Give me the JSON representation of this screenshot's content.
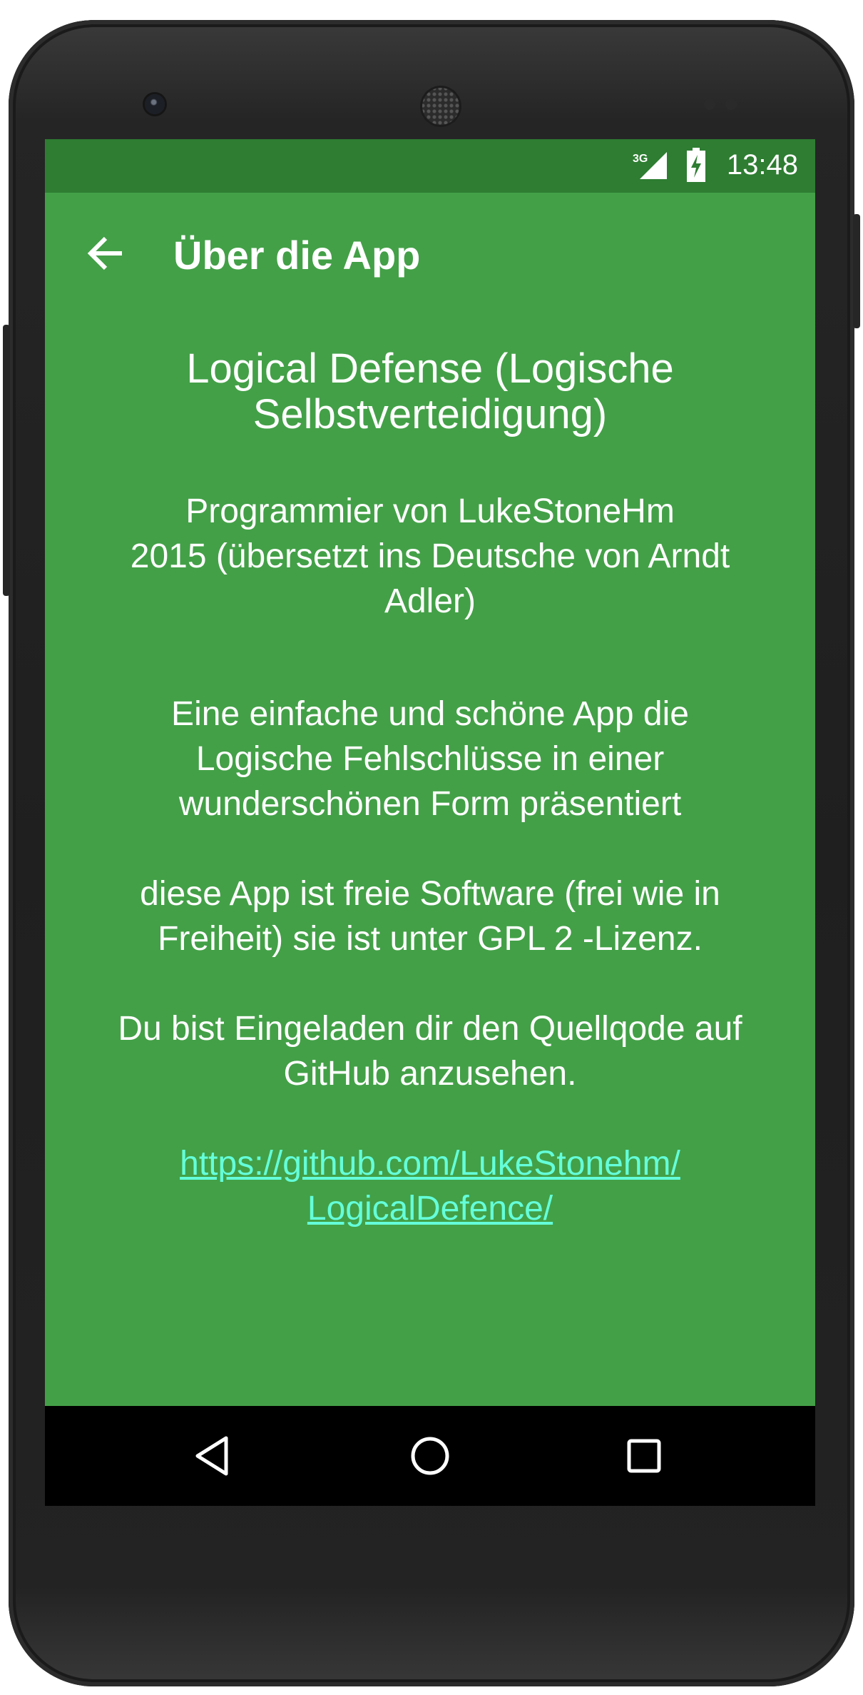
{
  "status_bar": {
    "network": "3G",
    "time": "13:48"
  },
  "toolbar": {
    "title": "Über die App"
  },
  "about": {
    "app_title_line1": "Logical Defense (Logische",
    "app_title_line2": "Selbstverteidigung)",
    "credit_line1": "Programmier von LukeStoneHm",
    "credit_line2": "2015 (übersetzt ins Deutsche von Arndt",
    "credit_line3": "Adler)",
    "description_line1": "Eine einfache und schöne App die",
    "description_line2": "Logische Fehlschlüsse in einer",
    "description_line3": "wunderschönen Form präsentiert",
    "license_line1": "diese App ist freie Software (frei wie in",
    "license_line2": "Freiheit) sie ist unter GPL 2 -Lizenz.",
    "invite_line1": "Du bist Eingeladen dir den Quellqode auf",
    "invite_line2": "GitHub anzusehen.",
    "link_line1": "https://github.com/LukeStonehm/",
    "link_line2": "LogicalDefence/"
  },
  "colors": {
    "background": "#43a047",
    "status_bar": "#2e7d32",
    "link": "#64ffda",
    "nav_bar": "#000000"
  },
  "icons": {
    "back": "arrow-left-icon",
    "signal": "cell-signal-icon",
    "battery": "battery-charging-icon",
    "nav_back": "triangle-back-icon",
    "nav_home": "circle-home-icon",
    "nav_recents": "square-recents-icon"
  }
}
